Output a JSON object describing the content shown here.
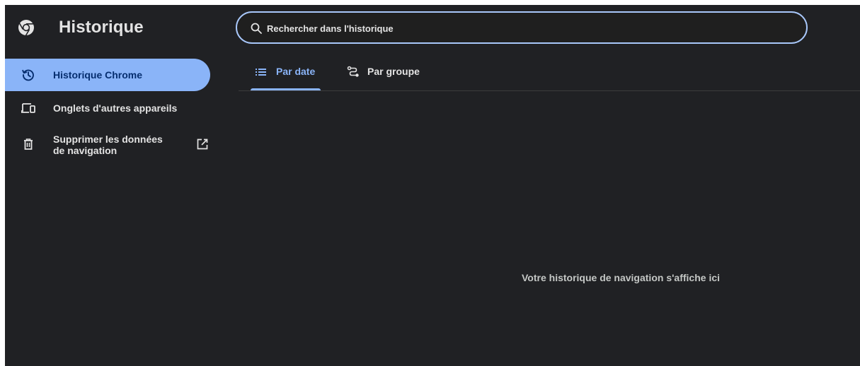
{
  "header": {
    "title": "Historique",
    "logo_icon": "chrome-logo-icon"
  },
  "search": {
    "placeholder": "Rechercher dans l'historique",
    "value": "",
    "icon": "search-icon",
    "border_color": "#a8c7fa"
  },
  "sidebar": {
    "items": [
      {
        "label": "Historique Chrome",
        "icon": "history-icon",
        "active": true
      },
      {
        "label": "Onglets d'autres appareils",
        "icon": "devices-icon",
        "active": false
      },
      {
        "label_line1": "Supprimer les données",
        "label_line2": "de navigation",
        "icon": "trash-icon",
        "trailing_icon": "open-in-new-icon",
        "active": false
      }
    ]
  },
  "tabs": [
    {
      "label": "Par date",
      "icon": "list-icon",
      "selected": true
    },
    {
      "label": "Par groupe",
      "icon": "journeys-icon",
      "selected": false
    }
  ],
  "main": {
    "empty_message": "Votre historique de navigation s'affiche ici"
  },
  "colors": {
    "background": "#202124",
    "accent": "#8ab4f8",
    "active_text": "#062e6f",
    "text": "#e3e3e3"
  }
}
